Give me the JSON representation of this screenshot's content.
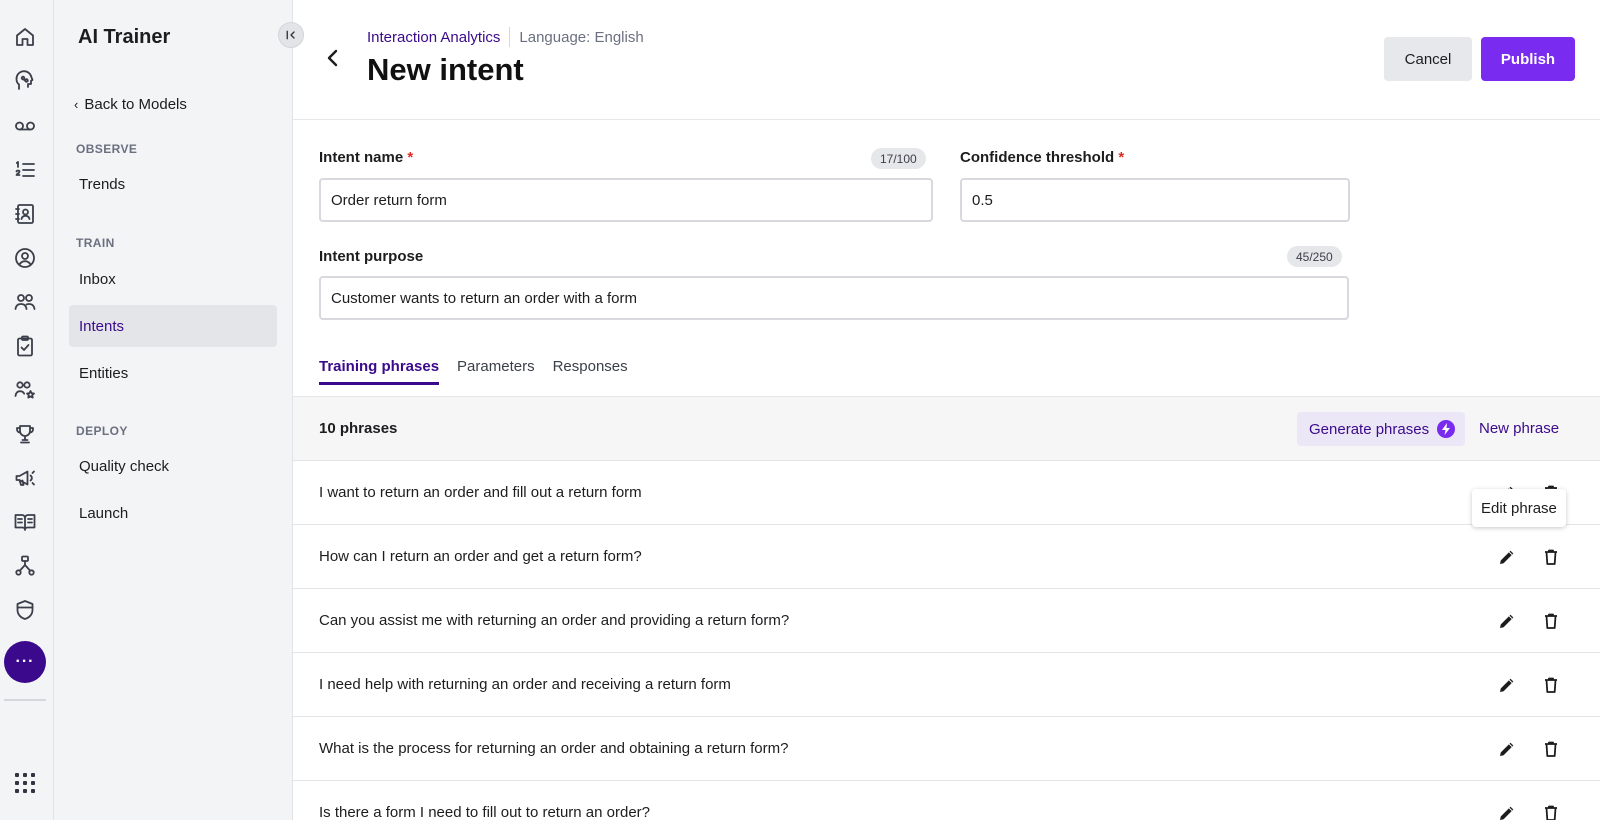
{
  "app": {
    "title": "AI Trainer"
  },
  "rail": {
    "icons": [
      "home-icon",
      "ai-head-icon",
      "voicemail-icon",
      "list-numbered-icon",
      "contacts-book-icon",
      "agent-icon",
      "team-icon",
      "clipboard-check-icon",
      "people-star-icon",
      "trophy-icon",
      "megaphone-icon",
      "book-open-icon",
      "workflow-icon",
      "shield-icon"
    ],
    "more_label": "···"
  },
  "sidebar": {
    "back_label": "Back to Models",
    "sections": [
      {
        "title": "OBSERVE",
        "items": [
          {
            "label": "Trends"
          }
        ]
      },
      {
        "title": "TRAIN",
        "items": [
          {
            "label": "Inbox"
          },
          {
            "label": "Intents",
            "active": true
          },
          {
            "label": "Entities"
          }
        ]
      },
      {
        "title": "DEPLOY",
        "items": [
          {
            "label": "Quality check"
          },
          {
            "label": "Launch"
          }
        ]
      }
    ]
  },
  "header": {
    "breadcrumb_link": "Interaction Analytics",
    "language": "Language: English",
    "title": "New intent",
    "cancel_label": "Cancel",
    "publish_label": "Publish"
  },
  "form": {
    "intent_name": {
      "label": "Intent name",
      "required": "*",
      "value": "Order return form",
      "counter": "17/100"
    },
    "confidence": {
      "label": "Confidence threshold",
      "required": "*",
      "value": "0.5"
    },
    "purpose": {
      "label": "Intent purpose",
      "value": "Customer wants to return an order with a form",
      "counter": "45/250"
    }
  },
  "tabs": [
    "Training phrases",
    "Parameters",
    "Responses"
  ],
  "phrases": {
    "count_label": "10 phrases",
    "generate_label": "Generate phrases",
    "new_label": "New phrase",
    "tooltip": "Edit phrase",
    "items": [
      "I want to return an order and fill out a return form",
      "How can I return an order and get a return form?",
      "Can you assist me with returning an order and providing a return form?",
      "I need help with returning an order and receiving a return form",
      "What is the process for returning an order and obtaining a return form?",
      "Is there a form I need to fill out to return an order?"
    ]
  },
  "colors": {
    "accent": "#3b0a8c",
    "primary_button": "#7a2bf0",
    "required": "#d92d20"
  }
}
